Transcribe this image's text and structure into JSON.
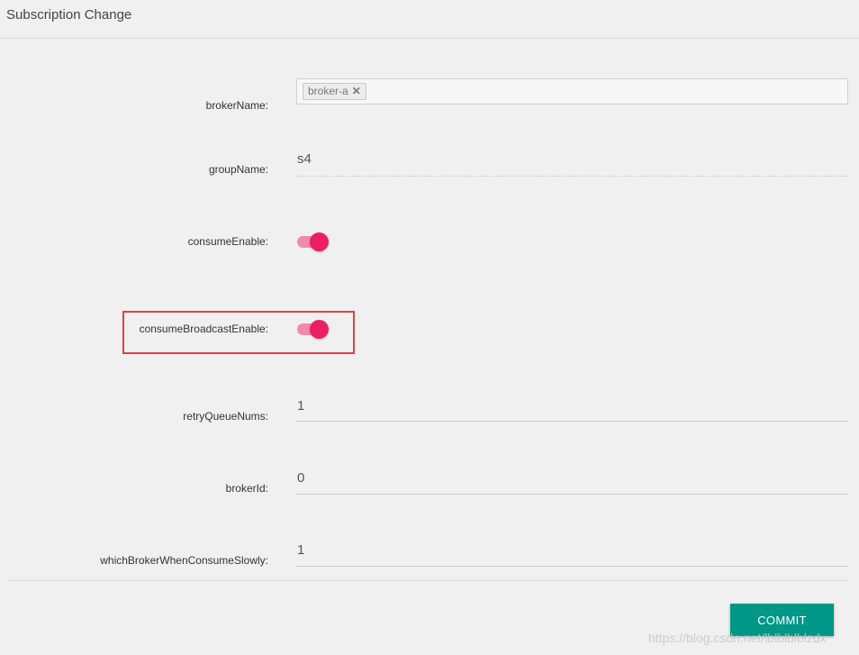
{
  "header": {
    "title": "Subscription Change"
  },
  "form": {
    "brokerName": {
      "label": "brokerName:",
      "chip": "broker-a",
      "chip_remove": "✕"
    },
    "groupName": {
      "label": "groupName:",
      "value": "s4"
    },
    "consumeEnable": {
      "label": "consumeEnable:",
      "checked": true
    },
    "consumeBroadcastEnable": {
      "label": "consumeBroadcastEnable:",
      "checked": true
    },
    "retryQueueNums": {
      "label": "retryQueueNums:",
      "value": "1"
    },
    "brokerId": {
      "label": "brokerId:",
      "value": "0"
    },
    "whichBrokerWhenConsumeSlowly": {
      "label": "whichBrokerWhenConsumeSlowly:",
      "value": "1"
    }
  },
  "footer": {
    "commit_label": "COMMIT"
  },
  "watermark": "https://blog.csdn.net/lblblblblzdx",
  "colors": {
    "accent": "#009688",
    "toggle_knob": "#ec1f63",
    "toggle_track": "#f08aa8",
    "highlight": "#e04040"
  }
}
